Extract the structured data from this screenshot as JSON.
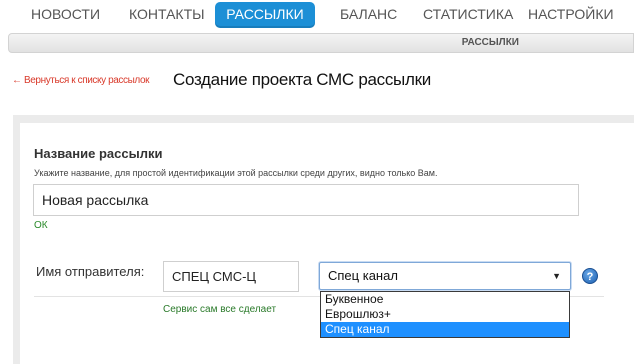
{
  "nav": {
    "items": [
      {
        "label": "НОВОСТИ"
      },
      {
        "label": "КОНТАКТЫ"
      },
      {
        "label": "РАССЫЛКИ"
      },
      {
        "label": "БАЛАНС"
      },
      {
        "label": "СТАТИСТИКА"
      },
      {
        "label": "НАСТРОЙКИ"
      }
    ],
    "active_index": 2,
    "active_color": "#1c8fd6"
  },
  "subbar": {
    "label": "РАССЫЛКИ"
  },
  "header": {
    "back_link": "← Вернуться к списку рассылок",
    "title": "Создание проекта СМС рассылки"
  },
  "form": {
    "name_label": "Название рассылки",
    "name_hint": "Укажите название, для простой идентификации этой рассылки среди других, видно только Вам.",
    "name_value": "Новая рассылка",
    "name_status": "ОК",
    "sender_label": "Имя отправителя:",
    "sender_value": "СПЕЦ СМС-Ц",
    "sender_type_selected": "Спец канал",
    "sender_type_options": [
      "Буквенное",
      "Еврошлюз+",
      "Спец канал"
    ],
    "service_note": "Сервис сам все сделает",
    "help_icon": "question-mark-icon"
  }
}
